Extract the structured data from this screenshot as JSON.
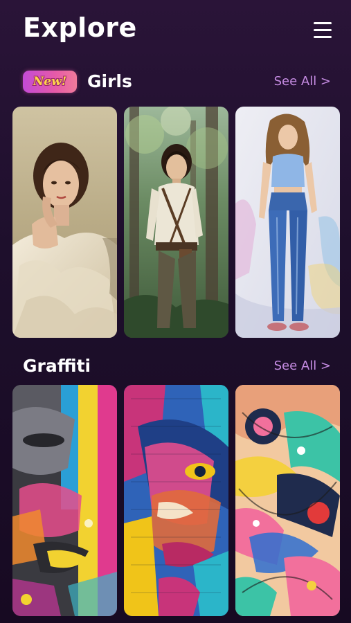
{
  "header": {
    "title": "Explore",
    "menu_icon": "hamburger-menu-icon"
  },
  "sections": [
    {
      "title": "Girls",
      "badge": "New!",
      "see_all": "See All >",
      "items": [
        {
          "kind": "portrait",
          "palette": [
            "#c7b896",
            "#f0e6d3",
            "#4a2d1f",
            "#d6a98c"
          ]
        },
        {
          "kind": "adventurer",
          "palette": [
            "#5f7f5a",
            "#e9e3d2",
            "#5d5642",
            "#2c1c12"
          ]
        },
        {
          "kind": "watercolor",
          "palette": [
            "#e9e8f1",
            "#3f6bb5",
            "#8fb2e0",
            "#b38b5a"
          ]
        }
      ]
    },
    {
      "title": "Graffiti",
      "see_all": "See All >",
      "items": [
        {
          "kind": "graffiti-face",
          "palette": [
            "#e03a8e",
            "#2a9fd6",
            "#f2d230",
            "#3b3b3b"
          ]
        },
        {
          "kind": "graffiti-pop",
          "palette": [
            "#c8347a",
            "#2f63b8",
            "#f0c419",
            "#2bb5c9"
          ]
        },
        {
          "kind": "graffiti-abstract",
          "palette": [
            "#f2709c",
            "#1f2b4d",
            "#f4d03f",
            "#3cc3a6"
          ]
        }
      ]
    }
  ]
}
